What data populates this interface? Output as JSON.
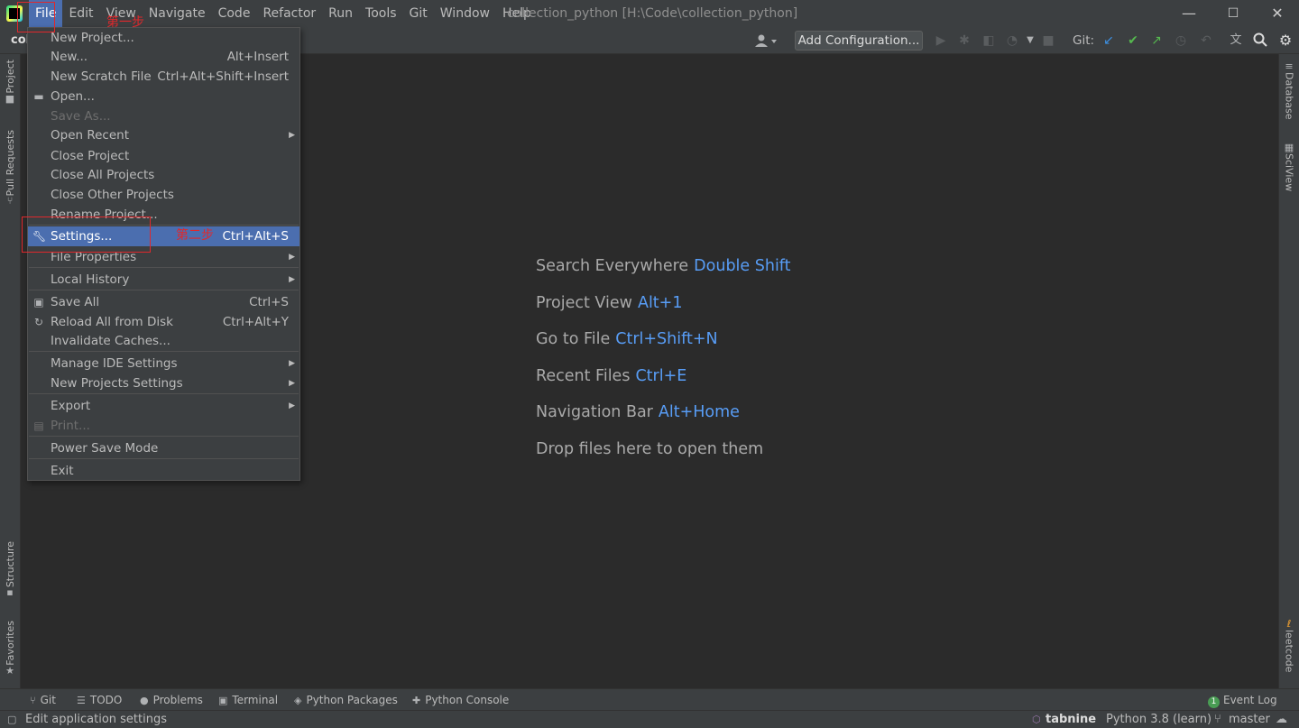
{
  "menubar": {
    "items": [
      "File",
      "Edit",
      "View",
      "Navigate",
      "Code",
      "Refactor",
      "Run",
      "Tools",
      "Git",
      "Window",
      "Help"
    ]
  },
  "window_title": "collection_python [H:\\Code\\collection_python]",
  "window_controls": {
    "minimize": "—",
    "maximize": "☐",
    "close": "✕"
  },
  "toolbar": {
    "project_crumb": "col",
    "add_config_label": "Add Configuration...",
    "git_label": "Git:"
  },
  "file_menu": {
    "items": [
      {
        "label": "New Project...",
        "shortcut": ""
      },
      {
        "label": "New...",
        "shortcut": "Alt+Insert"
      },
      {
        "label": "New Scratch File",
        "shortcut": "Ctrl+Alt+Shift+Insert"
      },
      {
        "label": "Open...",
        "shortcut": ""
      },
      {
        "label": "Save As...",
        "shortcut": ""
      },
      {
        "label": "Open Recent",
        "shortcut": ""
      },
      {
        "label": "Close Project",
        "shortcut": ""
      },
      {
        "label": "Close All Projects",
        "shortcut": ""
      },
      {
        "label": "Close Other Projects",
        "shortcut": ""
      },
      {
        "label": "Rename Project...",
        "shortcut": ""
      },
      {
        "label": "Settings...",
        "shortcut": "Ctrl+Alt+S"
      },
      {
        "label": "File Properties",
        "shortcut": ""
      },
      {
        "label": "Local History",
        "shortcut": ""
      },
      {
        "label": "Save All",
        "shortcut": "Ctrl+S"
      },
      {
        "label": "Reload All from Disk",
        "shortcut": "Ctrl+Alt+Y"
      },
      {
        "label": "Invalidate Caches...",
        "shortcut": ""
      },
      {
        "label": "Manage IDE Settings",
        "shortcut": ""
      },
      {
        "label": "New Projects Settings",
        "shortcut": ""
      },
      {
        "label": "Export",
        "shortcut": ""
      },
      {
        "label": "Print...",
        "shortcut": ""
      },
      {
        "label": "Power Save Mode",
        "shortcut": ""
      },
      {
        "label": "Exit",
        "shortcut": ""
      }
    ]
  },
  "annotations": {
    "step1": "第一步",
    "step2": "第二步"
  },
  "hints": [
    {
      "label": "Search Everywhere",
      "key": "Double Shift"
    },
    {
      "label": "Project View",
      "key": "Alt+1"
    },
    {
      "label": "Go to File",
      "key": "Ctrl+Shift+N"
    },
    {
      "label": "Recent Files",
      "key": "Ctrl+E"
    },
    {
      "label": "Navigation Bar",
      "key": "Alt+Home"
    },
    {
      "label": "Drop files here to open them",
      "key": ""
    }
  ],
  "left_tabs": [
    "Project",
    "Pull Requests",
    "Structure",
    "Favorites"
  ],
  "right_tabs": [
    "Database",
    "SciView",
    "leetcode"
  ],
  "bottom_tabs": [
    "Git",
    "TODO",
    "Problems",
    "Terminal",
    "Python Packages",
    "Python Console"
  ],
  "event_log": {
    "badge": "1",
    "label": "Event Log"
  },
  "status": {
    "message": "Edit application settings",
    "tabnine": "tabnine",
    "interpreter": "Python 3.8 (learn)",
    "branch": "master"
  },
  "colors": {
    "accent": "#4b6eaf",
    "shortcut_key": "#589df6",
    "annotation_red": "#e0282c",
    "background": "#2b2b2b",
    "panel": "#3c3f41"
  }
}
